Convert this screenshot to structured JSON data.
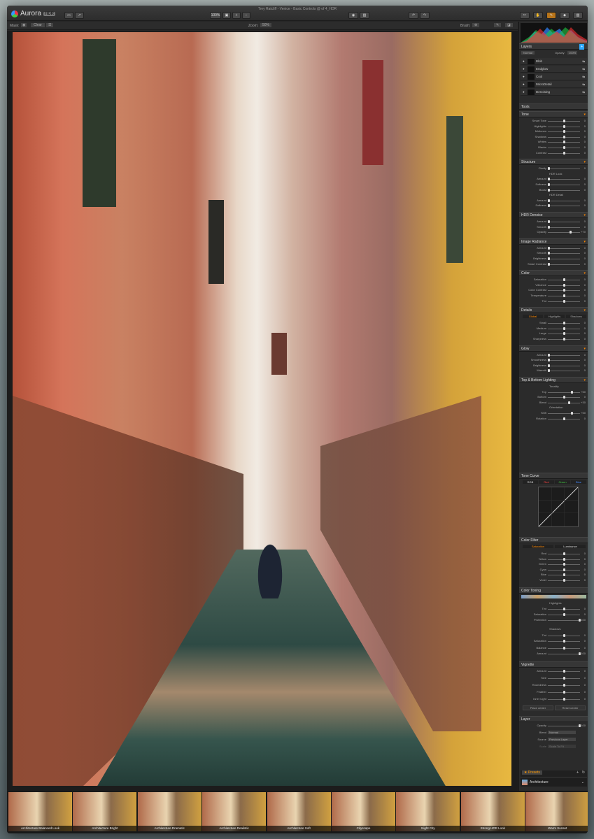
{
  "app": {
    "name": "Aurora",
    "badge": "HDR",
    "window_title": "Trey Ratcliff - Venice - Basic Controls @ of 4_HDR"
  },
  "toolbar": {
    "zoom_value": "100%",
    "mask_label": "Mask:",
    "mask_mode": "Clear",
    "zoom_label": "Zoom:",
    "zoom_pct": "50%",
    "brush_label": "Brush:"
  },
  "colors": {
    "accent": "#2ea8ff",
    "panel_bg": "#2b2b2b",
    "header_bg": "#363636"
  },
  "layers": {
    "title": "Layers",
    "blend_mode": "Normal",
    "opacity_label": "Opacity:",
    "opacity_value": "100%",
    "items": [
      "Blob",
      "Endglow",
      "Cool",
      "MicroDetail",
      "Denoising"
    ]
  },
  "tools_title": "Tools",
  "sections": [
    {
      "title": "Tone",
      "rows": [
        {
          "label": "Smart Tone",
          "value": "0",
          "pos": 0.5
        },
        {
          "label": "Highlights",
          "value": "0",
          "pos": 0.5
        },
        {
          "label": "Midtones",
          "value": "0",
          "pos": 0.5
        },
        {
          "label": "Shadows",
          "value": "0",
          "pos": 0.5
        },
        {
          "label": "Whites",
          "value": "0",
          "pos": 0.5
        },
        {
          "label": "Blacks",
          "value": "0",
          "pos": 0.5
        },
        {
          "label": "Contrast",
          "value": "0",
          "pos": 0.5
        }
      ]
    },
    {
      "title": "Structure",
      "rows": [
        {
          "label": "Clarity",
          "value": "0",
          "pos": 0.0
        },
        {
          "label": "HDR Look",
          "value": "",
          "pos": -1
        },
        {
          "label": "Amount",
          "value": "0",
          "pos": 0.0
        },
        {
          "label": "Softness",
          "value": "0",
          "pos": 0.0
        },
        {
          "label": "Boost",
          "value": "0",
          "pos": 0.0
        },
        {
          "label": "HDR Detail",
          "value": "",
          "pos": -1
        },
        {
          "label": "Amount",
          "value": "0",
          "pos": 0.0
        },
        {
          "label": "Softness",
          "value": "0",
          "pos": 0.0
        }
      ]
    },
    {
      "title": "HDR Denoise",
      "rows": [
        {
          "label": "Amount",
          "value": "0",
          "pos": 0.0
        },
        {
          "label": "Smooth",
          "value": "0",
          "pos": 0.0
        },
        {
          "label": "Opacity",
          "value": "+70",
          "pos": 0.7
        }
      ]
    },
    {
      "title": "Image Radiance",
      "rows": [
        {
          "label": "Amount",
          "value": "0",
          "pos": 0.0
        },
        {
          "label": "Smooth",
          "value": "0",
          "pos": 0.0
        },
        {
          "label": "Brightness",
          "value": "0",
          "pos": 0.0
        },
        {
          "label": "Smart Contrast",
          "value": "0",
          "pos": 0.0
        }
      ]
    },
    {
      "title": "Color",
      "rows": [
        {
          "label": "Saturation",
          "value": "0",
          "pos": 0.5
        },
        {
          "label": "Vibrance",
          "value": "0",
          "pos": 0.5
        },
        {
          "label": "Color Contrast",
          "value": "0",
          "pos": 0.5
        },
        {
          "label": "Temperature",
          "value": "0",
          "pos": 0.5
        },
        {
          "label": "Tint",
          "value": "0",
          "pos": 0.5
        }
      ]
    },
    {
      "title": "Details",
      "tabs": [
        "Global",
        "Highlights",
        "Shadows"
      ],
      "rows": [
        {
          "label": "Small",
          "value": "0",
          "pos": 0.5
        },
        {
          "label": "Medium",
          "value": "0",
          "pos": 0.5
        },
        {
          "label": "Large",
          "value": "0",
          "pos": 0.5
        },
        {
          "label": "Sharpness",
          "value": "0",
          "pos": 0.5
        }
      ]
    },
    {
      "title": "Glow",
      "rows": [
        {
          "label": "Amount",
          "value": "0",
          "pos": 0.0
        },
        {
          "label": "Smoothness",
          "value": "0",
          "pos": 0.0
        },
        {
          "label": "Brightness",
          "value": "0",
          "pos": 0.0
        },
        {
          "label": "Warmth",
          "value": "0",
          "pos": 0.0
        }
      ]
    },
    {
      "title": "Top & Bottom Lighting",
      "rows": [
        {
          "label": "Tonality",
          "value": "",
          "pos": -1
        },
        {
          "label": "Top",
          "value": "+50",
          "pos": 0.75
        },
        {
          "label": "Bottom",
          "value": "0",
          "pos": 0.5
        },
        {
          "label": "Blend",
          "value": "+30",
          "pos": 0.65
        },
        {
          "label": "Orientation",
          "value": "",
          "pos": -1
        },
        {
          "label": "Shift",
          "value": "+50",
          "pos": 0.75
        },
        {
          "label": "Rotation",
          "value": "0",
          "pos": 0.5
        }
      ]
    }
  ],
  "tone_curve": {
    "title": "Tone Curve",
    "channels": [
      "RGB",
      "Red",
      "Green",
      "Blue"
    ]
  },
  "color_filter": {
    "title": "Color Filter",
    "tabs": [
      "Saturation",
      "Luminance"
    ],
    "rows": [
      {
        "label": "Red",
        "value": "0"
      },
      {
        "label": "Yellow",
        "value": "0"
      },
      {
        "label": "Green",
        "value": "0"
      },
      {
        "label": "Cyan",
        "value": "0"
      },
      {
        "label": "Blue",
        "value": "0"
      },
      {
        "label": "Violet",
        "value": "0"
      }
    ]
  },
  "color_toning": {
    "title": "Color Toning",
    "highlights_label": "Highlights",
    "shadows_label": "Shadows",
    "rows": [
      {
        "label": "Tint",
        "value": "0"
      },
      {
        "label": "Saturation",
        "value": "0"
      },
      {
        "label": "Protection",
        "value": "+100"
      },
      {
        "label": "Tint",
        "value": "0"
      },
      {
        "label": "Saturation",
        "value": "0"
      },
      {
        "label": "Balance",
        "value": "0"
      },
      {
        "label": "Amount",
        "value": "+100"
      }
    ]
  },
  "vignette": {
    "title": "Vignette",
    "rows": [
      {
        "label": "Amount",
        "value": "0"
      },
      {
        "label": "Size",
        "value": "0"
      },
      {
        "label": "Roundness",
        "value": "0"
      },
      {
        "label": "Feather",
        "value": "0"
      },
      {
        "label": "Inner Light",
        "value": "0"
      }
    ],
    "buttons": [
      "Place center",
      "Reset center"
    ]
  },
  "layer_section": {
    "title": "Layer",
    "opacity_label": "Opacity",
    "opacity_value": "+100",
    "blend_label": "Blend",
    "blend_value": "Normal",
    "source_label": "Source",
    "source_value": "Previous Layer",
    "scale_label": "Scale",
    "scale_value": "Scale To Fit"
  },
  "presets": {
    "tab": "Presets",
    "category": "Architecture"
  },
  "filmstrip": [
    "Architecture Balanced Look",
    "Architecture Bright",
    "Architecture Dramatic",
    "Architecture Realistic",
    "Architecture Soft",
    "Cityscape",
    "Night City",
    "Strong HDR Look",
    "Warm Sunset"
  ]
}
